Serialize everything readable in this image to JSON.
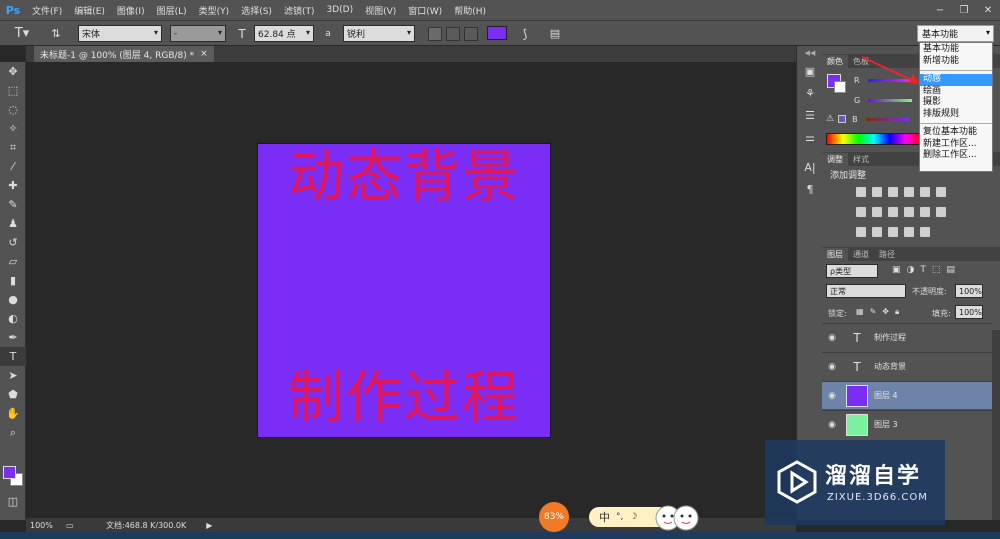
{
  "app": {
    "logo": "Ps",
    "menus": [
      "文件(F)",
      "编辑(E)",
      "图像(I)",
      "图层(L)",
      "类型(Y)",
      "选择(S)",
      "滤镜(T)",
      "3D(D)",
      "视图(V)",
      "窗口(W)",
      "帮助(H)"
    ]
  },
  "options_bar": {
    "font_family": "宋体",
    "font_style": "-",
    "font_size": "62.84 点",
    "aa_label": "a",
    "antialias": "锐利",
    "text_color": "#7a2ef5"
  },
  "workspace": {
    "current": "基本功能",
    "menu_items": [
      "基本功能",
      "新增功能",
      "动感",
      "绘画",
      "摄影",
      "排版规则",
      "复位基本功能",
      "新建工作区...",
      "删除工作区..."
    ],
    "selected": "动感"
  },
  "document": {
    "tab_title": "未标题-1 @ 100% (图层 4, RGB/8) *",
    "close": "×",
    "background_color": "#7a2ef5",
    "text_color": "#e0155a",
    "texts": [
      "动态背景",
      "制作过程"
    ]
  },
  "status_bar": {
    "zoom": "100%",
    "doc_info": "文档:468.8 K/300.0K"
  },
  "colors": {
    "foreground": "#7a2ef5",
    "background": "#ffffff"
  },
  "panels": {
    "color_tabs": [
      "颜色",
      "色板"
    ],
    "channels": [
      "R",
      "G",
      "B"
    ],
    "adjust_tabs": [
      "调整",
      "样式"
    ],
    "adjust_title": "添加调整",
    "layer_tabs": [
      "图层",
      "通道",
      "路径"
    ],
    "kind_filter": "ρ类型",
    "blend_mode": "正常",
    "opacity_label": "不透明度:",
    "opacity_value": "100%",
    "lock_label": "锁定:",
    "fill_label": "填充:",
    "fill_value": "100%",
    "layers": [
      {
        "name": "制作过程",
        "type": "text"
      },
      {
        "name": "动态背景",
        "type": "text"
      },
      {
        "name": "图层 4",
        "type": "pixel",
        "color": "#7a2ef5",
        "selected": true
      },
      {
        "name": "图层 3",
        "type": "pixel",
        "color": "#7af0a0"
      }
    ]
  },
  "watermark": {
    "title": "溜溜自学",
    "url": "ZIXUE.3D66.COM"
  },
  "ime": {
    "percent": "83%",
    "mode": "中"
  }
}
